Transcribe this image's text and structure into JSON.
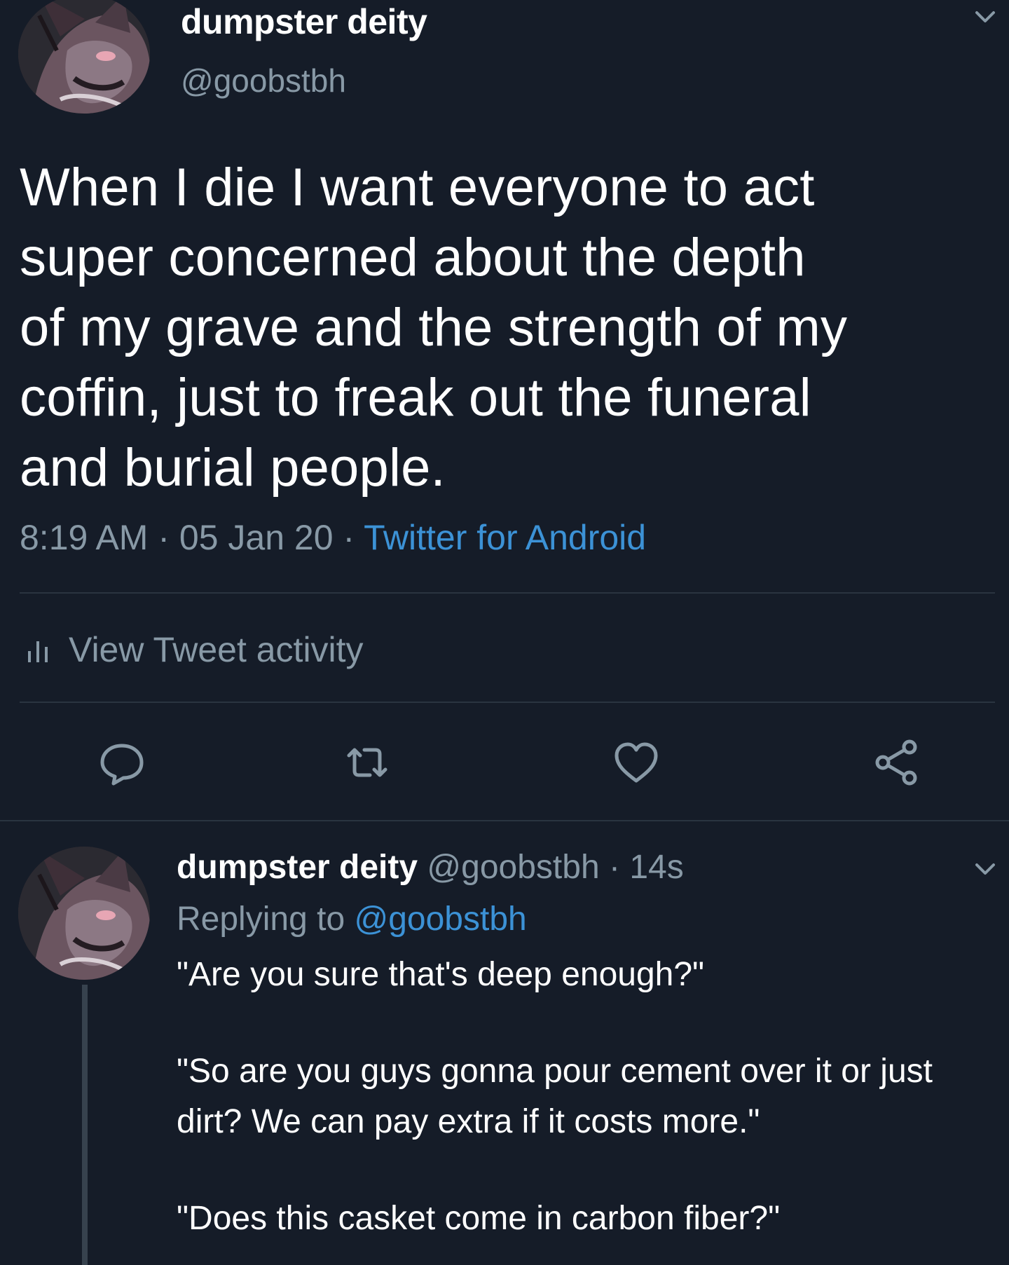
{
  "main_tweet": {
    "display_name": "dumpster deity",
    "handle": "@goobstbh",
    "text": "When I die I want everyone to act\nsuper concerned about the depth\nof my grave and the strength of my\ncoffin, just to freak out the funeral\nand burial people.",
    "time": "8:19 AM",
    "separator": "·",
    "date": "05 Jan 20",
    "source": "Twitter for Android",
    "activity_label": "View Tweet activity",
    "icons": {
      "menu": "chevron-down-icon",
      "activity": "bar-chart-icon",
      "reply": "comment-bubble-icon",
      "retweet": "retweet-icon",
      "like": "heart-icon",
      "share": "share-nodes-icon"
    }
  },
  "reply_tweet": {
    "display_name": "dumpster deity",
    "handle": "@goobstbh",
    "separator": "·",
    "age": "14s",
    "replying_to_prefix": "Replying to",
    "replying_to_handle": "@goobstbh",
    "paragraphs": [
      "\"Are you sure that's deep enough?\"",
      "\"So are you guys gonna pour cement over it or just dirt? We can pay extra if it costs more.\"",
      "\"Does this casket come in carbon fiber?\""
    ]
  },
  "colors": {
    "background": "#151c28",
    "secondary_text": "#8899a6",
    "link": "#3c92d6",
    "divider": "#2a3440"
  }
}
